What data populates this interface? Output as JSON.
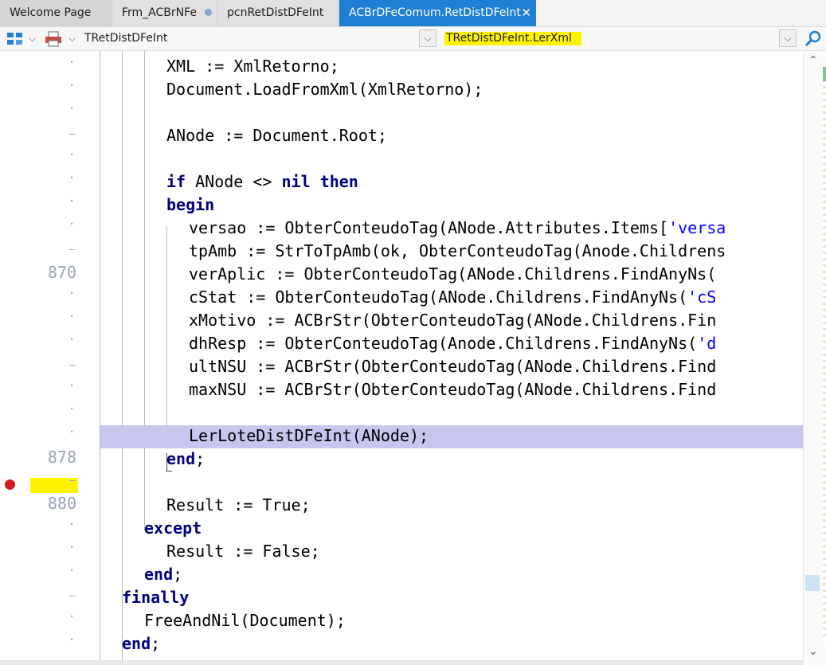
{
  "tabs": [
    {
      "label": "Welcome Page",
      "state": "inactive"
    },
    {
      "label": "Frm_ACBrNFe",
      "state": "modified"
    },
    {
      "label": "pcnRetDistDFeInt",
      "state": "inactive"
    },
    {
      "label": "ACBrDFeComum.RetDistDFeInt",
      "state": "active"
    }
  ],
  "toolbar": {
    "class_selector": "TRetDistDFeInt",
    "method_selector": "TRetDistDFeInt.LerXml"
  },
  "colors": {
    "active_tab": "#1e7fd3",
    "keyword": "#000080",
    "string": "#0000ff",
    "execution_line": "#c6c6ef",
    "highlight": "#fff200",
    "breakpoint": "#d11d1d"
  },
  "icons": [
    "structure-icon",
    "dropdown-chevron-icon",
    "print-icon",
    "search-icon",
    "scroll-up-icon",
    "scroll-down-icon",
    "breakpoint-icon",
    "close-icon"
  ],
  "editor": {
    "line_numbers": [
      {
        "row": 9,
        "label": "870"
      },
      {
        "row": 17,
        "label": "878"
      },
      {
        "row": 19,
        "label": "880"
      }
    ],
    "breakpoint_line": "878",
    "lines": [
      {
        "indent": 3,
        "tokens": [
          {
            "t": "XML := XmlRetorno;",
            "k": "plain"
          }
        ]
      },
      {
        "indent": 3,
        "tokens": [
          {
            "t": "Document.LoadFromXml(XmlRetorno);",
            "k": "plain"
          }
        ]
      },
      {
        "indent": 3,
        "tokens": []
      },
      {
        "indent": 3,
        "tokens": [
          {
            "t": "ANode := Document.Root;",
            "k": "plain"
          }
        ]
      },
      {
        "indent": 3,
        "tokens": []
      },
      {
        "indent": 3,
        "tokens": [
          {
            "t": "if",
            "k": "kw"
          },
          {
            "t": " ANode <> ",
            "k": "plain"
          },
          {
            "t": "nil",
            "k": "kw"
          },
          {
            "t": " ",
            "k": "plain"
          },
          {
            "t": "then",
            "k": "kw"
          }
        ]
      },
      {
        "indent": 3,
        "tokens": [
          {
            "t": "begin",
            "k": "kw"
          }
        ]
      },
      {
        "indent": 4,
        "tokens": [
          {
            "t": "versao := ObterConteudoTag(ANode.Attributes.Items[",
            "k": "plain"
          },
          {
            "t": "'versa",
            "k": "str"
          }
        ]
      },
      {
        "indent": 4,
        "tokens": [
          {
            "t": "tpAmb := StrToTpAmb(ok, ObterConteudoTag(Anode.Childrens",
            "k": "plain"
          }
        ]
      },
      {
        "indent": 4,
        "tokens": [
          {
            "t": "verAplic := ObterConteudoTag(ANode.Childrens.FindAnyNs(",
            "k": "plain"
          }
        ]
      },
      {
        "indent": 4,
        "tokens": [
          {
            "t": "cStat := ObterConteudoTag(ANode.Childrens.FindAnyNs(",
            "k": "plain"
          },
          {
            "t": "'cS",
            "k": "str"
          }
        ]
      },
      {
        "indent": 4,
        "tokens": [
          {
            "t": "xMotivo := ACBrStr(ObterConteudoTag(ANode.Childrens.Fin",
            "k": "plain"
          }
        ]
      },
      {
        "indent": 4,
        "tokens": [
          {
            "t": "dhResp := ObterConteudoTag(Anode.Childrens.FindAnyNs(",
            "k": "plain"
          },
          {
            "t": "'d",
            "k": "str"
          }
        ]
      },
      {
        "indent": 4,
        "tokens": [
          {
            "t": "ultNSU := ACBrStr(ObterConteudoTag(ANode.Childrens.Find",
            "k": "plain"
          }
        ]
      },
      {
        "indent": 4,
        "tokens": [
          {
            "t": "maxNSU := ACBrStr(ObterConteudoTag(ANode.Childrens.Find",
            "k": "plain"
          }
        ]
      },
      {
        "indent": 4,
        "tokens": []
      },
      {
        "indent": 4,
        "tokens": [
          {
            "t": "LerLoteDistDFeInt(ANode);",
            "k": "plain"
          }
        ]
      },
      {
        "indent": 3,
        "tokens": [
          {
            "t": "end",
            "k": "kw"
          },
          {
            "t": ";",
            "k": "plain"
          }
        ]
      },
      {
        "indent": 3,
        "tokens": []
      },
      {
        "indent": 3,
        "tokens": [
          {
            "t": "Result := True;",
            "k": "plain"
          }
        ]
      },
      {
        "indent": 2,
        "tokens": [
          {
            "t": "except",
            "k": "kw"
          }
        ]
      },
      {
        "indent": 3,
        "tokens": [
          {
            "t": "Result := False;",
            "k": "plain"
          }
        ]
      },
      {
        "indent": 2,
        "tokens": [
          {
            "t": "end",
            "k": "kw"
          },
          {
            "t": ";",
            "k": "plain"
          }
        ]
      },
      {
        "indent": 1,
        "tokens": [
          {
            "t": "finally",
            "k": "kw"
          }
        ]
      },
      {
        "indent": 2,
        "tokens": [
          {
            "t": "FreeAndNil(Document);",
            "k": "plain"
          }
        ]
      },
      {
        "indent": 1,
        "tokens": [
          {
            "t": "end",
            "k": "kw"
          },
          {
            "t": ";",
            "k": "plain"
          }
        ]
      }
    ]
  }
}
